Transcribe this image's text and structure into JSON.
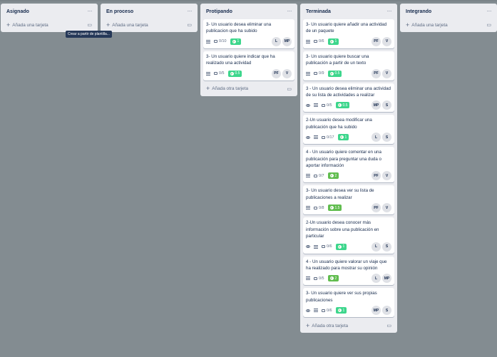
{
  "colors": {
    "board_bg": "#838c91",
    "list_bg": "#ebecf0",
    "points_green": "#61bd4f",
    "points_light_green": "#3dd68c"
  },
  "menu_glyph": "···",
  "template_icon": "template-icon",
  "tooltip": "Crear a partir de plantilla...",
  "lists": [
    {
      "title": "Asignado",
      "add_label": "Añada una tarjeta",
      "cards": []
    },
    {
      "title": "En proceso",
      "add_label": "Añada una tarjeta",
      "cards": []
    },
    {
      "title": "Protipando",
      "add_label": "Añada otra tarjeta",
      "cards": [
        {
          "title": "3- Un usuario desea eliminar una publicacion que ha subido",
          "watch": false,
          "checklist": "0/10",
          "points": "1",
          "points_style": "light",
          "members": [
            "L",
            "MP"
          ]
        },
        {
          "title": "3- Un usuario quiere indicar que ha realizado una actividad",
          "watch": false,
          "checklist": "0/5",
          "points": "0.5",
          "points_style": "light",
          "members": [
            "PF",
            "V"
          ]
        }
      ]
    },
    {
      "title": "Terminada",
      "add_label": "Añada otra tarjeta",
      "cards": [
        {
          "title": "3- Un usuario quiere añadir una actividad de un paquete",
          "watch": false,
          "checklist": "0/6",
          "points": "1",
          "points_style": "light",
          "members": [
            "PF",
            "V"
          ]
        },
        {
          "title": "3- Un usuario quiere buscar una publicación a partir de un texto",
          "watch": false,
          "checklist": "0/9",
          "points": "0.5",
          "points_style": "light",
          "members": [
            "PF",
            "V"
          ]
        },
        {
          "title": "3 - Un usuario desea eliminar una actividad de su lista de actividades a realizar",
          "watch": true,
          "checklist": "0/5",
          "points": "0.5",
          "points_style": "light",
          "members": [
            "MP",
            "S"
          ]
        },
        {
          "title": "2-Un usuario desea modificar una publicación que ha subido",
          "watch": true,
          "checklist": "0/17",
          "points": "1",
          "points_style": "light",
          "members": [
            "L",
            "S"
          ]
        },
        {
          "title": "4 - Un usuario quiere comentar en una publicación para preguntar una duda o aportar información",
          "watch": false,
          "checklist": "0/7",
          "points": "2",
          "points_style": "dark",
          "members": [
            "PF",
            "V"
          ]
        },
        {
          "title": "3- Un usuario desea ver su lista de publicaciones a realizar",
          "watch": false,
          "checklist": "0/8",
          "points": "1.5",
          "points_style": "dark",
          "members": [
            "PF",
            "V"
          ]
        },
        {
          "title": "2-Un usuario desea conocer más información sobre una publicación en particular",
          "watch": true,
          "checklist": "0/6",
          "points": "1",
          "points_style": "light",
          "members": [
            "L",
            "S"
          ]
        },
        {
          "title": "4 - Un usuario quiere valorar un viaje que ha realizado para mostrar su opinión",
          "watch": false,
          "checklist": "0/5",
          "points": "2",
          "points_style": "dark",
          "members": [
            "L",
            "MP"
          ]
        },
        {
          "title": "3- Un usuario quiere ver sus propias publicaciones",
          "watch": true,
          "checklist": "0/6",
          "points": "1",
          "points_style": "light",
          "members": [
            "MP",
            "S"
          ]
        }
      ]
    },
    {
      "title": "Integrando",
      "add_label": "Añada una tarjeta",
      "cards": []
    }
  ]
}
